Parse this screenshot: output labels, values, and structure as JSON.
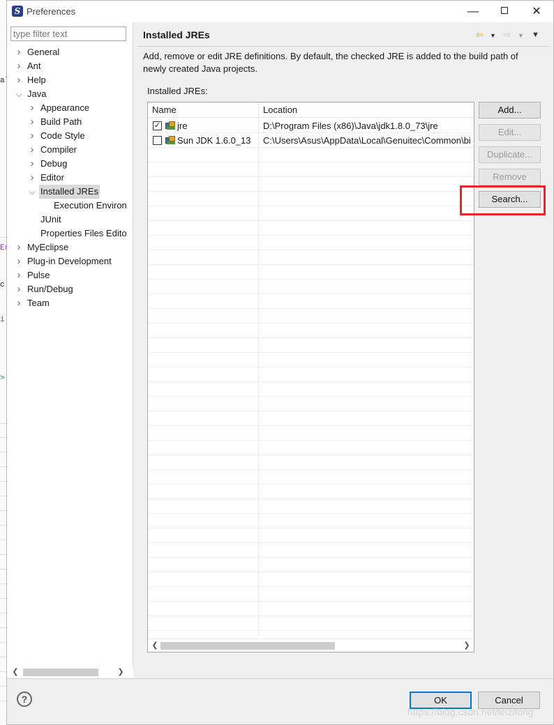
{
  "window": {
    "title": "Preferences",
    "minimize": "—",
    "close": "✕"
  },
  "sidebar": {
    "filter_placeholder": "type filter text",
    "items": [
      {
        "label": "General",
        "expanded": false
      },
      {
        "label": "Ant",
        "expanded": false
      },
      {
        "label": "Help",
        "expanded": false
      },
      {
        "label": "Java",
        "expanded": true
      },
      {
        "label": "Appearance",
        "expanded": false
      },
      {
        "label": "Build Path",
        "expanded": false
      },
      {
        "label": "Code Style",
        "expanded": false
      },
      {
        "label": "Compiler",
        "expanded": false
      },
      {
        "label": "Debug",
        "expanded": false
      },
      {
        "label": "Editor",
        "expanded": false
      },
      {
        "label": "Installed JREs",
        "expanded": true,
        "selected": true
      },
      {
        "label": "Execution Environ"
      },
      {
        "label": "JUnit"
      },
      {
        "label": "Properties Files Edito"
      },
      {
        "label": "MyEclipse",
        "expanded": false
      },
      {
        "label": "Plug-in Development",
        "expanded": false
      },
      {
        "label": "Pulse",
        "expanded": false
      },
      {
        "label": "Run/Debug",
        "expanded": false
      },
      {
        "label": "Team",
        "expanded": false
      }
    ]
  },
  "main": {
    "title": "Installed JREs",
    "description": "Add, remove or edit JRE definitions. By default, the checked JRE is added to the build path of newly created Java projects.",
    "list_label": "Installed JREs:",
    "columns": [
      "Name",
      "Location"
    ],
    "rows": [
      {
        "checked": true,
        "name": "jre",
        "location": "D:\\Program Files (x86)\\Java\\jdk1.8.0_73\\jre"
      },
      {
        "checked": false,
        "name": "Sun JDK 1.6.0_13",
        "location": "C:\\Users\\Asus\\AppData\\Local\\Genuitec\\Common\\bi"
      }
    ],
    "buttons": {
      "add": "Add...",
      "edit": "Edit...",
      "duplicate": "Duplicate...",
      "remove": "Remove",
      "search": "Search..."
    }
  },
  "footer": {
    "help": "?",
    "ok": "OK",
    "cancel": "Cancel"
  },
  "watermark": "https://blog.csdn.net/leizifong",
  "colors": {
    "highlight": "#e8252a",
    "default_button_border": "#0078d7",
    "selected_tree_bg": "#d9d9d9"
  }
}
